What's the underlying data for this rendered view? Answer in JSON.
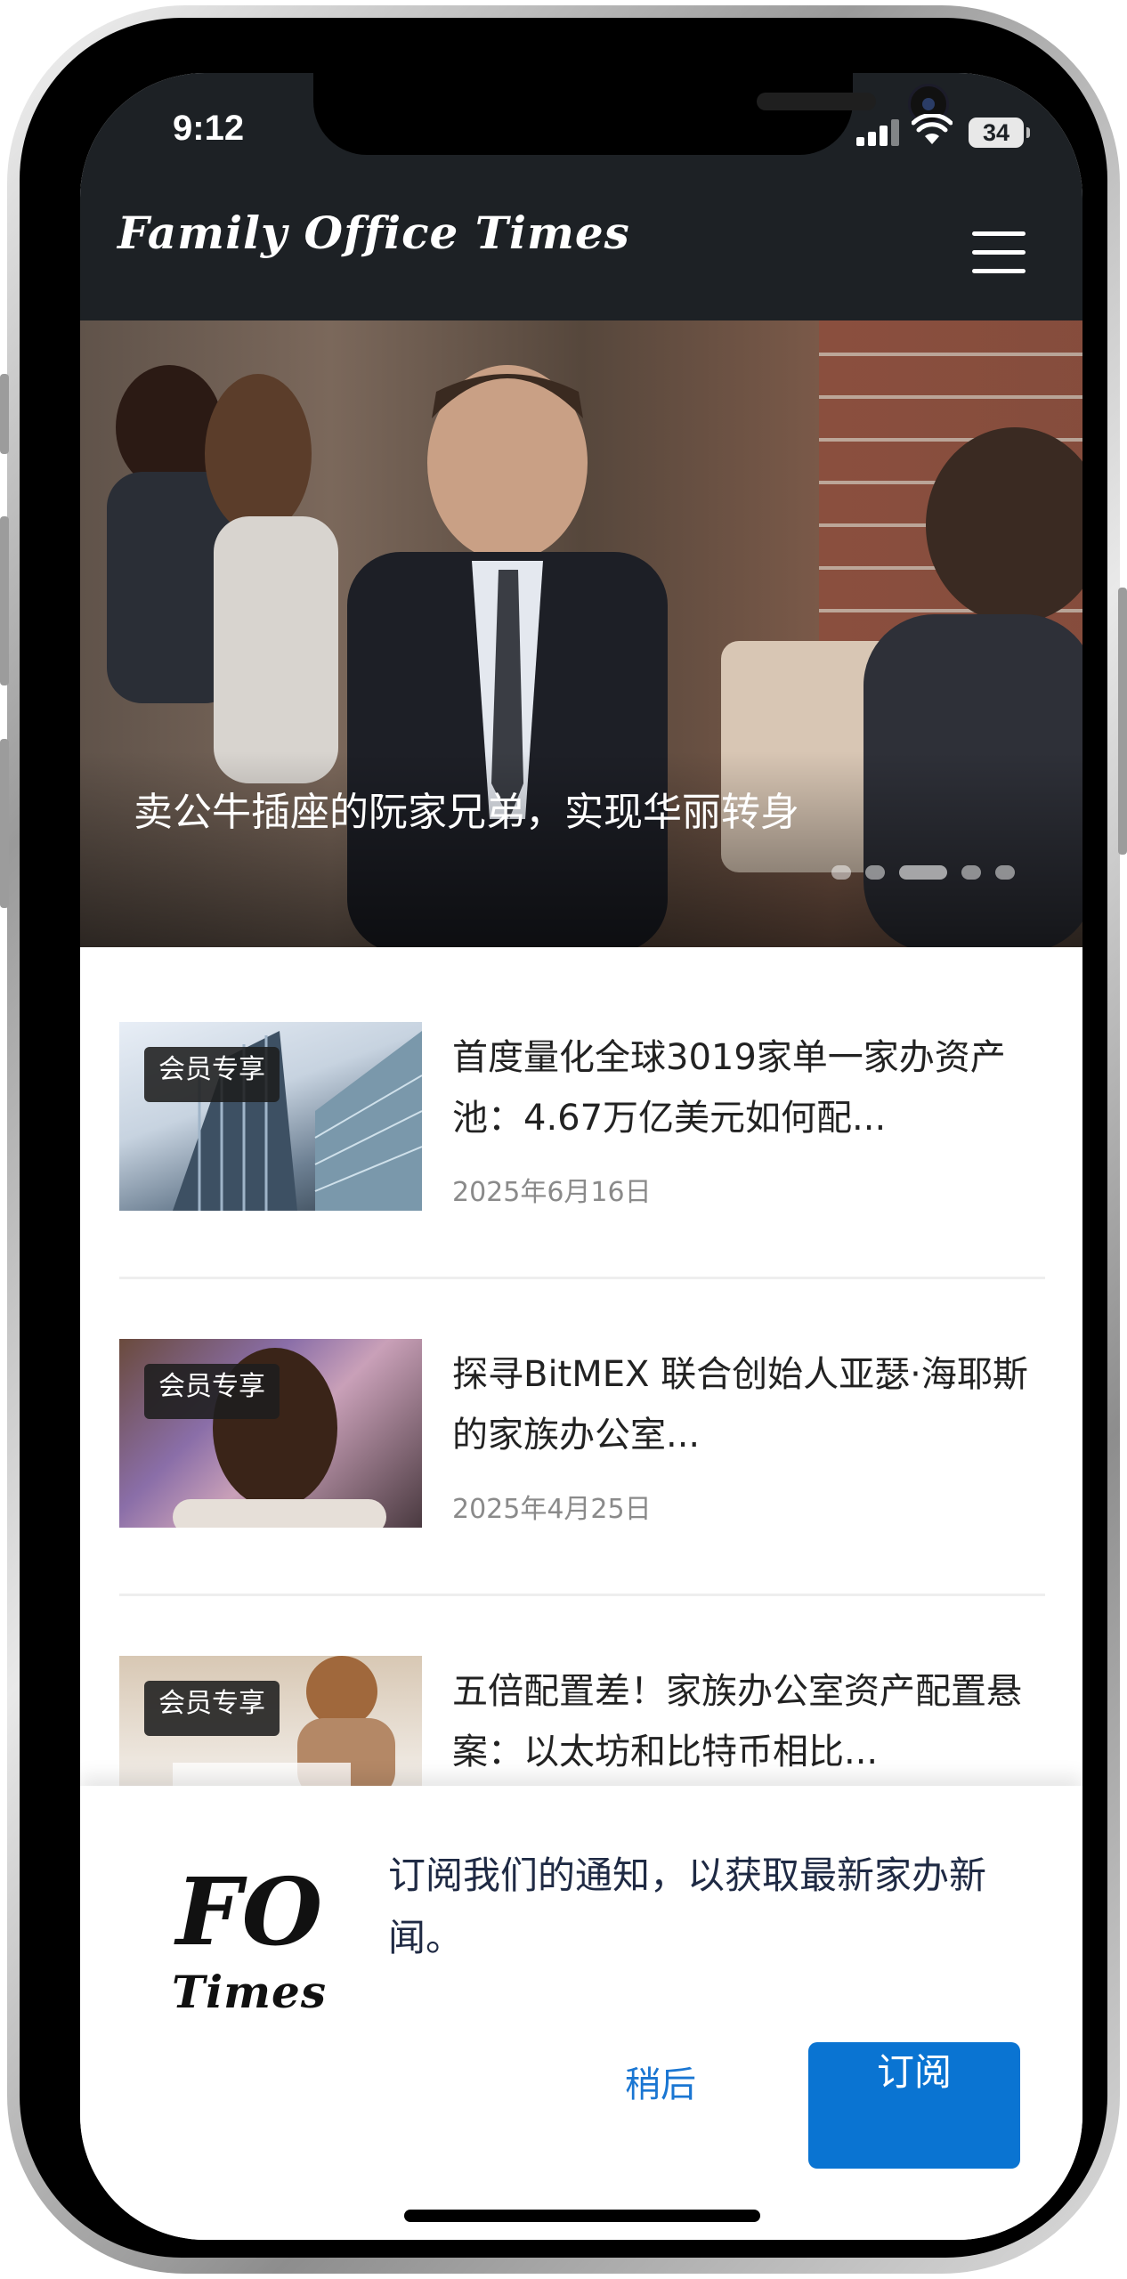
{
  "status_bar": {
    "time": "9:12",
    "battery": "34"
  },
  "header": {
    "site_title": "Family Office Times"
  },
  "hero": {
    "title": "卖公牛插座的阮家兄弟，实现华丽转身"
  },
  "articles": [
    {
      "badge": "会员专享",
      "title": "首度量化全球3019家单一家办资产池：4.67万亿美元如何配...",
      "date": "2025年6月16日"
    },
    {
      "badge": "会员专享",
      "title": "探寻BitMEX 联合创始人亚瑟·海耶斯的家族办公室...",
      "date": "2025年4月25日"
    },
    {
      "badge": "会员专享",
      "title": "五倍配置差！家族办公室资产配置悬案：以太坊和比特币相比..."
    }
  ],
  "subscribe": {
    "logo_big": "FO",
    "logo_small": "Times",
    "message": "订阅我们的通知，以获取最新家办新闻。",
    "later_label": "稍后",
    "subscribe_label": "订阅"
  }
}
